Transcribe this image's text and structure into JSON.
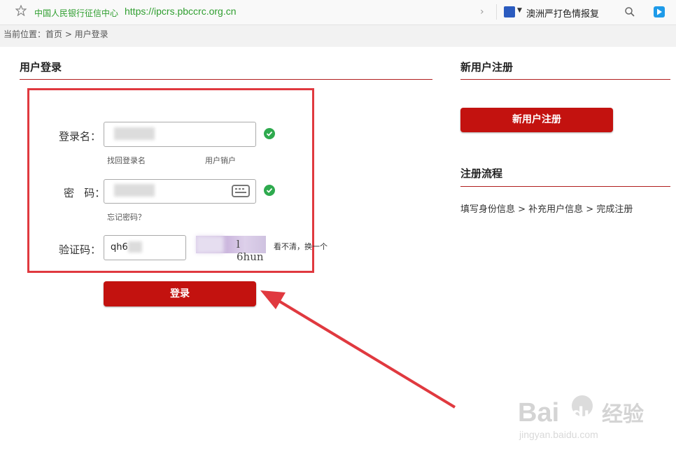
{
  "browser": {
    "site_name": "中国人民银行征信中心",
    "url": "https://ipcrs.pbccrc.org.cn",
    "search_query": "澳洲严打色情报复"
  },
  "breadcrumb": "当前位置：首页 > 用户登录",
  "login": {
    "title": "用户登录",
    "username_label": "登录名：",
    "find_username": "找回登录名",
    "cancel_account": "用户销户",
    "password_label": "密   码：",
    "forgot_password": "忘记密码？",
    "captcha_label": "验证码：",
    "captcha_input_value": "qh6",
    "captcha_image_text": "l 6hun",
    "refresh_captcha": "看不清，换一个",
    "submit_label": "登录"
  },
  "register": {
    "title": "新用户注册",
    "button_label": "新用户注册",
    "flow_title": "注册流程",
    "flow_steps": "填写身份信息 > 补充用户信息 > 完成注册"
  },
  "watermark": {
    "brand": "Baidu经验",
    "url": "jingyan.baidu.com"
  },
  "colors": {
    "accent_red": "#c3120f",
    "highlight_box": "#e0393f",
    "ok_green": "#2eaa4e",
    "url_green": "#2f9e2f"
  }
}
